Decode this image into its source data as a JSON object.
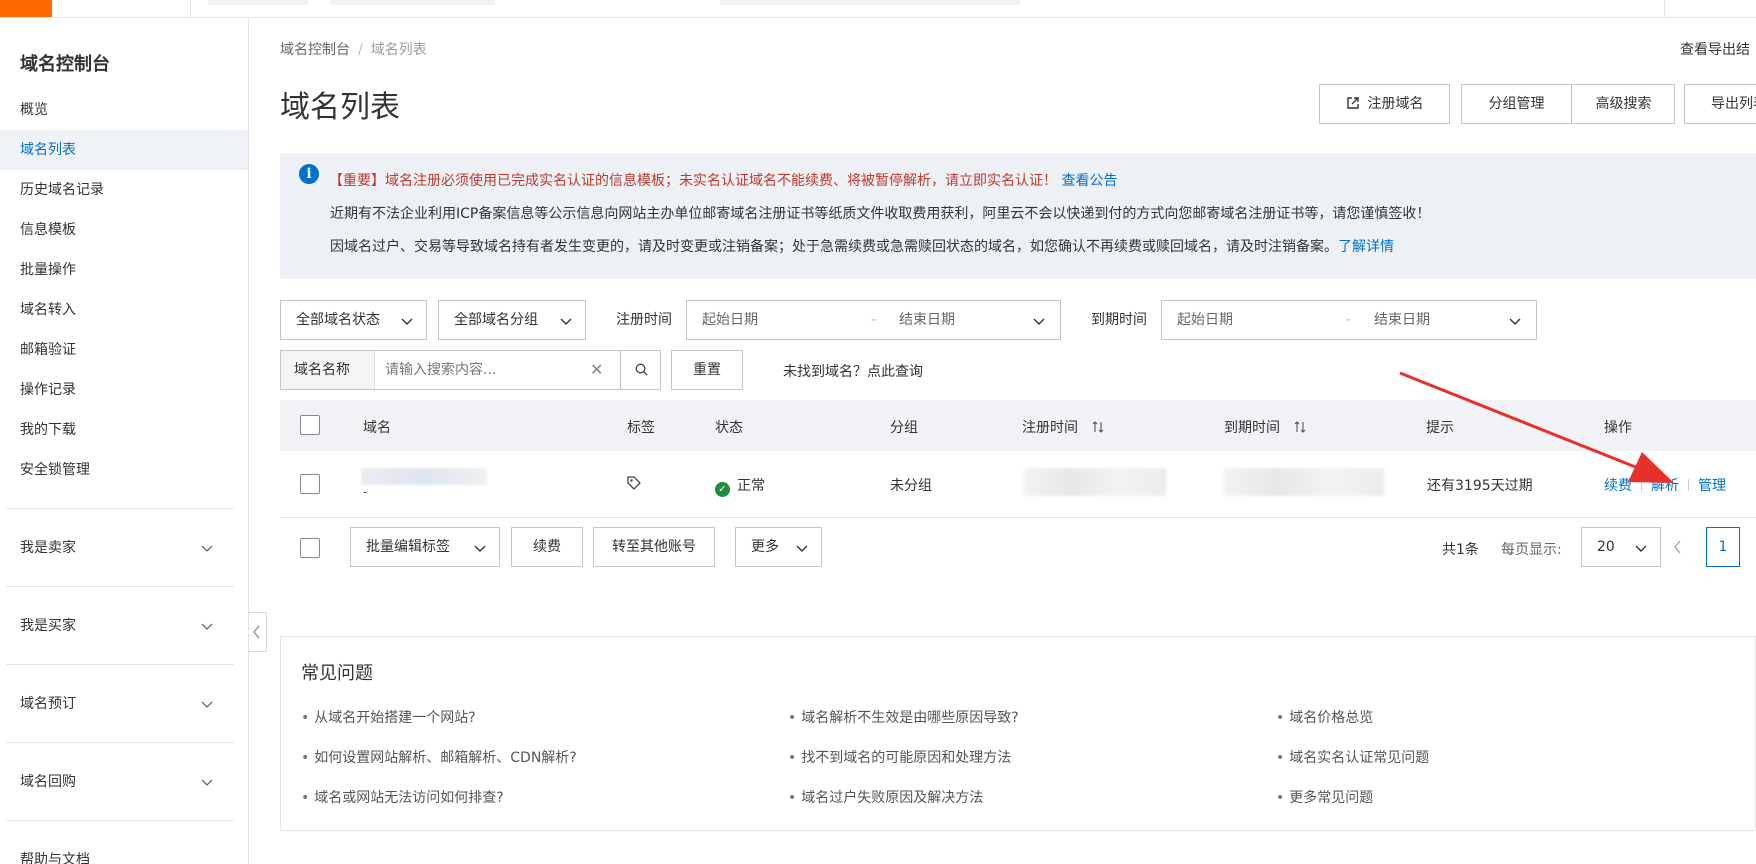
{
  "sidebar": {
    "title": "域名控制台",
    "items": [
      {
        "label": "概览"
      },
      {
        "label": "域名列表"
      },
      {
        "label": "历史域名记录"
      },
      {
        "label": "信息模板"
      },
      {
        "label": "批量操作"
      },
      {
        "label": "域名转入"
      },
      {
        "label": "邮箱验证"
      },
      {
        "label": "操作记录"
      },
      {
        "label": "我的下载"
      },
      {
        "label": "安全锁管理"
      }
    ],
    "groups": [
      {
        "label": "我是卖家"
      },
      {
        "label": "我是买家"
      },
      {
        "label": "域名预订"
      },
      {
        "label": "域名回购"
      },
      {
        "label": "帮助与文档"
      }
    ]
  },
  "breadcrumb": {
    "root": "域名控制台",
    "current": "域名列表"
  },
  "export_results_link": "查看导出结",
  "page_title": "域名列表",
  "toolbar": {
    "register": "注册域名",
    "group_manage": "分组管理",
    "advanced_search": "高级搜索",
    "export_list": "导出列表"
  },
  "notice": {
    "line1": "【重要】域名注册必须使用已完成实名认证的信息模板；未实名认证域名不能续费、将被暂停解析，请立即实名认证！",
    "line1_link": "查看公告",
    "line2": "近期有不法企业利用ICP备案信息等公示信息向网站主办单位邮寄域名注册证书等纸质文件收取费用获利，阿里云不会以快递到付的方式向您邮寄域名注册证书等，请您谨慎签收！",
    "line3": "因域名过户、交易等导致域名持有者发生变更的，请及时变更或注销备案；处于急需续费或急需赎回状态的域名，如您确认不再续费或赎回域名，请及时注销备案。",
    "line3_link": "了解详情"
  },
  "filters": {
    "status": "全部域名状态",
    "group": "全部域名分组",
    "reg_time_label": "注册时间",
    "exp_time_label": "到期时间",
    "start_date": "起始日期",
    "end_date": "结束日期",
    "date_separator": "-",
    "search_prefix": "域名名称",
    "search_placeholder": "请输入搜索内容...",
    "reset": "重置",
    "not_found_link": "未找到域名？点此查询"
  },
  "table": {
    "headers": {
      "domain": "域名",
      "tag": "标签",
      "status": "状态",
      "group": "分组",
      "reg_time": "注册时间",
      "exp_time": "到期时间",
      "tip": "提示",
      "actions": "操作"
    },
    "rows": [
      {
        "domain_sub": "-",
        "status": "正常",
        "group": "未分组",
        "tip": "还有3195天过期",
        "actions": [
          "续费",
          "解析",
          "管理"
        ]
      }
    ]
  },
  "bulk": {
    "edit_tags": "批量编辑标签",
    "renew": "续费",
    "transfer": "转至其他账号",
    "more": "更多"
  },
  "pagination": {
    "total": "共1条",
    "per_page_label": "每页显示:",
    "per_page": "20",
    "current_page": "1"
  },
  "faq": {
    "title": "常见问题",
    "items": [
      "从域名开始搭建一个网站?",
      "域名解析不生效是由哪些原因导致?",
      "域名价格总览",
      "如何设置网站解析、邮箱解析、CDN解析?",
      "找不到域名的可能原因和处理方法",
      "域名实名认证常见问题",
      "域名或网站无法访问如何排查?",
      "域名过户失败原因及解决方法",
      "更多常见问题"
    ]
  },
  "colors": {
    "accent": "#0070cc",
    "brand": "#ff6a00",
    "warning_text": "#c0392b",
    "arrow": "#e8302a",
    "ok": "#1e8e3e"
  }
}
